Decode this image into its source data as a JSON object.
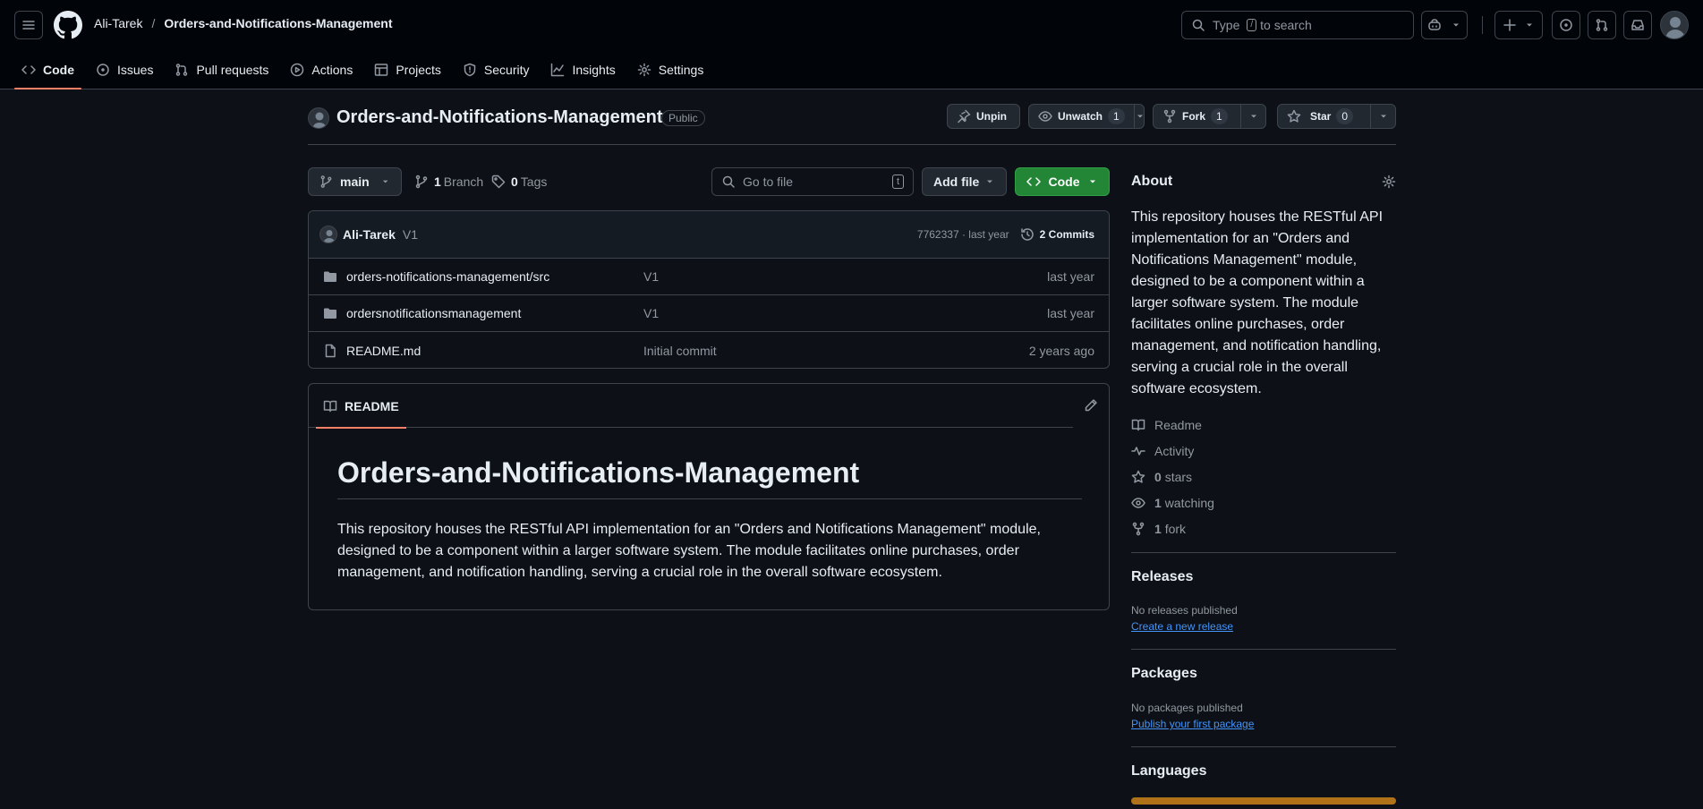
{
  "header": {
    "owner": "Ali-Tarek",
    "separator": "/",
    "repo": "Orders-and-Notifications-Management",
    "search": {
      "prefix": "Type",
      "key": "/",
      "suffix": "to search"
    }
  },
  "repo_nav": {
    "tabs": [
      {
        "label": "Code",
        "icon": "code-icon",
        "active": true
      },
      {
        "label": "Issues",
        "icon": "issue-icon"
      },
      {
        "label": "Pull requests",
        "icon": "pull-request-icon"
      },
      {
        "label": "Actions",
        "icon": "play-icon"
      },
      {
        "label": "Projects",
        "icon": "table-icon"
      },
      {
        "label": "Security",
        "icon": "shield-icon"
      },
      {
        "label": "Insights",
        "icon": "graph-icon"
      },
      {
        "label": "Settings",
        "icon": "gear-icon"
      }
    ]
  },
  "repo_head": {
    "title": "Orders-and-Notifications-Management",
    "visibility": "Public",
    "unpin": "Unpin",
    "unwatch": "Unwatch",
    "watch_count": "1",
    "fork": "Fork",
    "fork_count": "1",
    "star": "Star",
    "star_count": "0"
  },
  "toolbar": {
    "branch": "main",
    "branches_count": "1",
    "branches_label": "Branch",
    "tags_count": "0",
    "tags_label": "Tags",
    "goto_placeholder": "Go to file",
    "goto_key": "t",
    "add_file": "Add file",
    "code": "Code"
  },
  "latest_commit": {
    "author": "Ali-Tarek",
    "message": "V1",
    "sha_time": "7762337 · last year",
    "commits": "2 Commits"
  },
  "files": [
    {
      "name": "orders-notifications-management/src",
      "message": "V1",
      "date": "last year",
      "type": "dir"
    },
    {
      "name": "ordersnotificationsmanagement",
      "message": "V1",
      "date": "last year",
      "type": "dir"
    },
    {
      "name": "README.md",
      "message": "Initial commit",
      "date": "2 years ago",
      "type": "file"
    }
  ],
  "readme": {
    "tab": "README",
    "heading": "Orders-and-Notifications-Management",
    "body": "This repository houses the RESTful API implementation for an \"Orders and Notifications Management\" module, designed to be a component within a larger software system. The module facilitates online purchases, order management, and notification handling, serving a crucial role in the overall software ecosystem."
  },
  "about": {
    "title": "About",
    "description": "This repository houses the RESTful API implementation for an \"Orders and Notifications Management\" module, designed to be a component within a larger software system. The module facilitates online purchases, order management, and notification handling, serving a crucial role in the overall software ecosystem.",
    "links": {
      "readme": "Readme",
      "activity": "Activity",
      "stars_count": "0",
      "stars_label": "stars",
      "watching_count": "1",
      "watching_label": "watching",
      "fork_count": "1",
      "fork_label": "fork"
    }
  },
  "releases": {
    "title": "Releases",
    "note": "No releases published",
    "link": "Create a new release"
  },
  "packages": {
    "title": "Packages",
    "note": "No packages published",
    "link": "Publish your first package"
  },
  "languages": {
    "title": "Languages",
    "bar_color": "#b07219"
  },
  "colors": {
    "accent_tab": "#f78166",
    "code_button": "#238636",
    "link": "#4493f8"
  }
}
